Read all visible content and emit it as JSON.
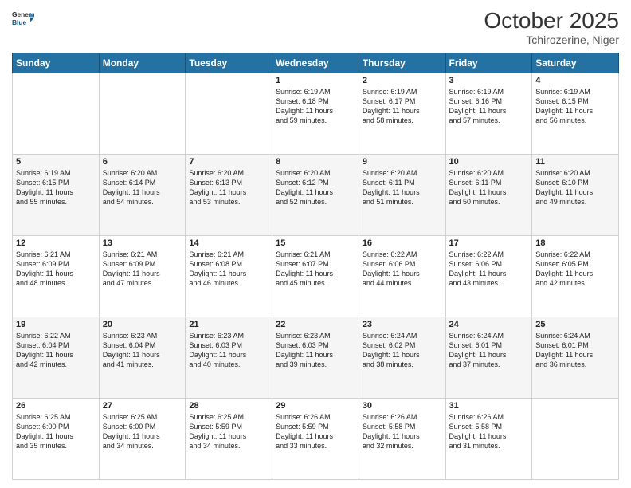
{
  "header": {
    "logo_line1": "General",
    "logo_line2": "Blue",
    "title": "October 2025",
    "subtitle": "Tchirozerine, Niger"
  },
  "days_of_week": [
    "Sunday",
    "Monday",
    "Tuesday",
    "Wednesday",
    "Thursday",
    "Friday",
    "Saturday"
  ],
  "weeks": [
    [
      {
        "day": "",
        "info": ""
      },
      {
        "day": "",
        "info": ""
      },
      {
        "day": "",
        "info": ""
      },
      {
        "day": "1",
        "info": "Sunrise: 6:19 AM\nSunset: 6:18 PM\nDaylight: 11 hours\nand 59 minutes."
      },
      {
        "day": "2",
        "info": "Sunrise: 6:19 AM\nSunset: 6:17 PM\nDaylight: 11 hours\nand 58 minutes."
      },
      {
        "day": "3",
        "info": "Sunrise: 6:19 AM\nSunset: 6:16 PM\nDaylight: 11 hours\nand 57 minutes."
      },
      {
        "day": "4",
        "info": "Sunrise: 6:19 AM\nSunset: 6:15 PM\nDaylight: 11 hours\nand 56 minutes."
      }
    ],
    [
      {
        "day": "5",
        "info": "Sunrise: 6:19 AM\nSunset: 6:15 PM\nDaylight: 11 hours\nand 55 minutes."
      },
      {
        "day": "6",
        "info": "Sunrise: 6:20 AM\nSunset: 6:14 PM\nDaylight: 11 hours\nand 54 minutes."
      },
      {
        "day": "7",
        "info": "Sunrise: 6:20 AM\nSunset: 6:13 PM\nDaylight: 11 hours\nand 53 minutes."
      },
      {
        "day": "8",
        "info": "Sunrise: 6:20 AM\nSunset: 6:12 PM\nDaylight: 11 hours\nand 52 minutes."
      },
      {
        "day": "9",
        "info": "Sunrise: 6:20 AM\nSunset: 6:11 PM\nDaylight: 11 hours\nand 51 minutes."
      },
      {
        "day": "10",
        "info": "Sunrise: 6:20 AM\nSunset: 6:11 PM\nDaylight: 11 hours\nand 50 minutes."
      },
      {
        "day": "11",
        "info": "Sunrise: 6:20 AM\nSunset: 6:10 PM\nDaylight: 11 hours\nand 49 minutes."
      }
    ],
    [
      {
        "day": "12",
        "info": "Sunrise: 6:21 AM\nSunset: 6:09 PM\nDaylight: 11 hours\nand 48 minutes."
      },
      {
        "day": "13",
        "info": "Sunrise: 6:21 AM\nSunset: 6:09 PM\nDaylight: 11 hours\nand 47 minutes."
      },
      {
        "day": "14",
        "info": "Sunrise: 6:21 AM\nSunset: 6:08 PM\nDaylight: 11 hours\nand 46 minutes."
      },
      {
        "day": "15",
        "info": "Sunrise: 6:21 AM\nSunset: 6:07 PM\nDaylight: 11 hours\nand 45 minutes."
      },
      {
        "day": "16",
        "info": "Sunrise: 6:22 AM\nSunset: 6:06 PM\nDaylight: 11 hours\nand 44 minutes."
      },
      {
        "day": "17",
        "info": "Sunrise: 6:22 AM\nSunset: 6:06 PM\nDaylight: 11 hours\nand 43 minutes."
      },
      {
        "day": "18",
        "info": "Sunrise: 6:22 AM\nSunset: 6:05 PM\nDaylight: 11 hours\nand 42 minutes."
      }
    ],
    [
      {
        "day": "19",
        "info": "Sunrise: 6:22 AM\nSunset: 6:04 PM\nDaylight: 11 hours\nand 42 minutes."
      },
      {
        "day": "20",
        "info": "Sunrise: 6:23 AM\nSunset: 6:04 PM\nDaylight: 11 hours\nand 41 minutes."
      },
      {
        "day": "21",
        "info": "Sunrise: 6:23 AM\nSunset: 6:03 PM\nDaylight: 11 hours\nand 40 minutes."
      },
      {
        "day": "22",
        "info": "Sunrise: 6:23 AM\nSunset: 6:03 PM\nDaylight: 11 hours\nand 39 minutes."
      },
      {
        "day": "23",
        "info": "Sunrise: 6:24 AM\nSunset: 6:02 PM\nDaylight: 11 hours\nand 38 minutes."
      },
      {
        "day": "24",
        "info": "Sunrise: 6:24 AM\nSunset: 6:01 PM\nDaylight: 11 hours\nand 37 minutes."
      },
      {
        "day": "25",
        "info": "Sunrise: 6:24 AM\nSunset: 6:01 PM\nDaylight: 11 hours\nand 36 minutes."
      }
    ],
    [
      {
        "day": "26",
        "info": "Sunrise: 6:25 AM\nSunset: 6:00 PM\nDaylight: 11 hours\nand 35 minutes."
      },
      {
        "day": "27",
        "info": "Sunrise: 6:25 AM\nSunset: 6:00 PM\nDaylight: 11 hours\nand 34 minutes."
      },
      {
        "day": "28",
        "info": "Sunrise: 6:25 AM\nSunset: 5:59 PM\nDaylight: 11 hours\nand 34 minutes."
      },
      {
        "day": "29",
        "info": "Sunrise: 6:26 AM\nSunset: 5:59 PM\nDaylight: 11 hours\nand 33 minutes."
      },
      {
        "day": "30",
        "info": "Sunrise: 6:26 AM\nSunset: 5:58 PM\nDaylight: 11 hours\nand 32 minutes."
      },
      {
        "day": "31",
        "info": "Sunrise: 6:26 AM\nSunset: 5:58 PM\nDaylight: 11 hours\nand 31 minutes."
      },
      {
        "day": "",
        "info": ""
      }
    ]
  ]
}
